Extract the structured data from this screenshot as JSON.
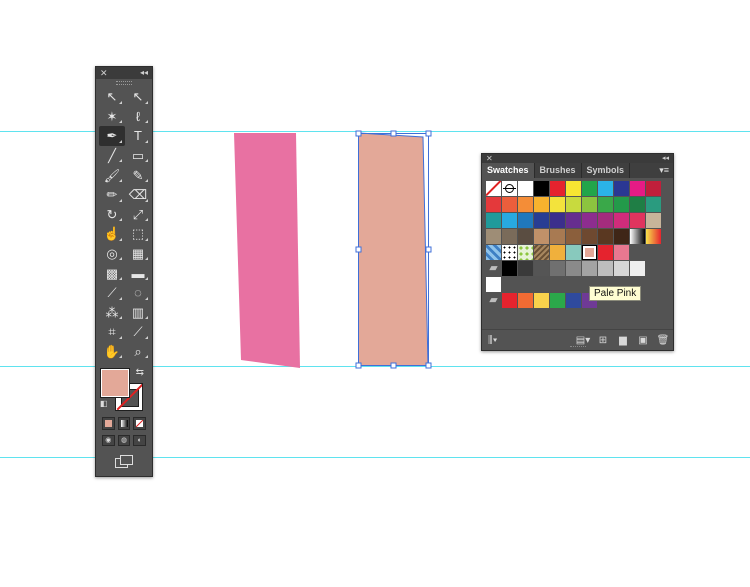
{
  "tools_panel": {
    "close_glyph": "✕",
    "collapse_glyph": "◂◂",
    "tools": [
      {
        "name": "selection-tool-icon",
        "glyph": "↖",
        "active": false
      },
      {
        "name": "direct-selection-tool-icon",
        "glyph": "↖",
        "active": false
      },
      {
        "name": "magic-wand-tool-icon",
        "glyph": "✶",
        "active": false
      },
      {
        "name": "lasso-tool-icon",
        "glyph": "ℓ",
        "active": false
      },
      {
        "name": "pen-tool-icon",
        "glyph": "✒",
        "active": true
      },
      {
        "name": "type-tool-icon",
        "glyph": "T",
        "active": false
      },
      {
        "name": "line-segment-tool-icon",
        "glyph": "╱",
        "active": false
      },
      {
        "name": "rectangle-tool-icon",
        "glyph": "▭",
        "active": false
      },
      {
        "name": "paintbrush-tool-icon",
        "glyph": "🖌",
        "active": false
      },
      {
        "name": "pencil-tool-icon",
        "glyph": "✎",
        "active": false
      },
      {
        "name": "blob-brush-tool-icon",
        "glyph": "✏",
        "active": false
      },
      {
        "name": "eraser-tool-icon",
        "glyph": "⌫",
        "active": false
      },
      {
        "name": "rotate-tool-icon",
        "glyph": "↻",
        "active": false
      },
      {
        "name": "scale-tool-icon",
        "glyph": "⤢",
        "active": false
      },
      {
        "name": "warp-tool-icon",
        "glyph": "☝",
        "active": false
      },
      {
        "name": "free-transform-tool-icon",
        "glyph": "⬚",
        "active": false
      },
      {
        "name": "shape-builder-tool-icon",
        "glyph": "◎",
        "active": false
      },
      {
        "name": "perspective-grid-tool-icon",
        "glyph": "▦",
        "active": false
      },
      {
        "name": "mesh-tool-icon",
        "glyph": "▩",
        "active": false
      },
      {
        "name": "gradient-tool-icon",
        "glyph": "▬",
        "active": false
      },
      {
        "name": "eyedropper-tool-icon",
        "glyph": "⟋",
        "active": false
      },
      {
        "name": "blend-tool-icon",
        "glyph": "◌",
        "active": false
      },
      {
        "name": "symbol-sprayer-tool-icon",
        "glyph": "⁂",
        "active": false
      },
      {
        "name": "column-graph-tool-icon",
        "glyph": "▥",
        "active": false
      },
      {
        "name": "artboard-tool-icon",
        "glyph": "⌗",
        "active": false
      },
      {
        "name": "slice-tool-icon",
        "glyph": "⟋",
        "active": false
      },
      {
        "name": "hand-tool-icon",
        "glyph": "✋",
        "active": false
      },
      {
        "name": "zoom-tool-icon",
        "glyph": "⌕",
        "active": false
      }
    ],
    "fill_color": "#e3a898",
    "swap_glyph": "⇆",
    "default_glyph": "◧"
  },
  "canvas": {
    "shape_left_color": "#e871a2",
    "shape_right_color": "#e3a898",
    "selection_color": "#3f6fd8",
    "guide_color": "#5fe3ef"
  },
  "swatches_panel": {
    "close_glyph": "✕",
    "collapse_glyph": "◂◂",
    "tabs": [
      {
        "label": "Swatches",
        "active": true
      },
      {
        "label": "Brushes",
        "active": false
      },
      {
        "label": "Symbols",
        "active": false
      }
    ],
    "menu_glyph": "▾≡",
    "rows": [
      [
        "none",
        "registration",
        "#ffffff",
        "#000000",
        "#e5232e",
        "#f7e532",
        "#22a54a",
        "#2bb3e7",
        "#2a3793",
        "#e61b85",
        "#c01f3b"
      ],
      [
        "#e4393b",
        "#eb5e3c",
        "#f48d37",
        "#f7b22e",
        "#f3e33c",
        "#c8da3e",
        "#8cc43f",
        "#3aa849",
        "#239a4a",
        "#1f7e45",
        "#2a9b7f"
      ],
      [
        "#209a9b",
        "#28a9e0",
        "#2078bc",
        "#283d93",
        "#3b2f8c",
        "#662e8f",
        "#8d2d8e",
        "#a42c7d",
        "#d02c7b",
        "#e0345e",
        "#c7b49a"
      ],
      [
        "#9e8d76",
        "#7a6b5a",
        "#5a4d41",
        "#c09169",
        "#a87a52",
        "#8b5f3c",
        "#6e4930",
        "#5a3821",
        "#3f2617",
        "#gradient-bw",
        "#gradient-orange"
      ],
      [
        "#pattern-blue",
        "#pattern-dots",
        "#pattern-green",
        "#pattern-leaf",
        "#f0b03c",
        "#88c9bd",
        "#e3a898",
        "#e5232e",
        "#e87890"
      ],
      [
        "folder",
        "#000000",
        "#3a3a3a",
        "#555555",
        "#707070",
        "#8a8a8a",
        "#a3a3a3",
        "#bdbdbd",
        "#d6d6d6",
        "#efefef"
      ],
      [
        "#ffffff"
      ],
      [
        "folder",
        "#e5232e",
        "#f26b33",
        "#f9d24c",
        "#2ba84a",
        "#2f4a9e",
        "#6f3a96"
      ]
    ],
    "selected_swatch": "#e3a898",
    "tooltip": "Pale Pink",
    "footer": {
      "libraries_glyph": "⫼▾",
      "buttons": [
        "▤▾",
        "⊞",
        "▆",
        "▣",
        "🗑"
      ]
    }
  }
}
